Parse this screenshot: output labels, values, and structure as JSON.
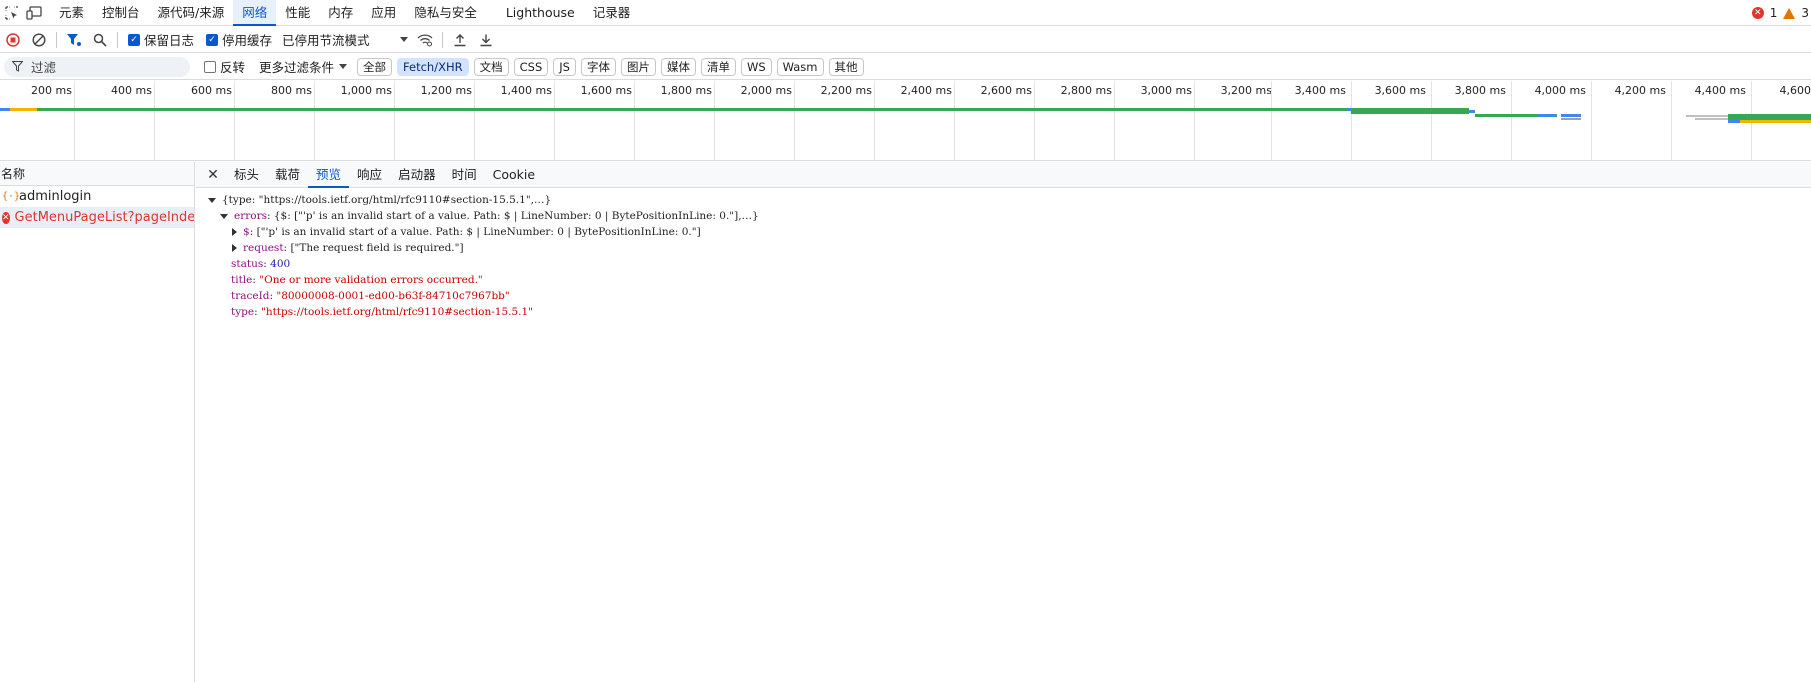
{
  "top_tabs": [
    "元素",
    "控制台",
    "源代码/来源",
    "网络",
    "性能",
    "内存",
    "应用",
    "隐私与安全",
    "Lighthouse",
    "记录器"
  ],
  "active_top_tab": "网络",
  "status": {
    "errors": "1",
    "warnings": "3"
  },
  "toolbar": {
    "preserve_log": "保留日志",
    "disable_cache": "停用缓存",
    "throttling": "已停用节流模式"
  },
  "filter": {
    "placeholder": "过滤",
    "invert": "反转",
    "more_filters": "更多过滤条件",
    "types": [
      "全部",
      "Fetch/XHR",
      "文档",
      "CSS",
      "JS",
      "字体",
      "图片",
      "媒体",
      "清单",
      "WS",
      "Wasm",
      "其他"
    ],
    "active_type": "Fetch/XHR"
  },
  "timeline_labels": [
    "200 ms",
    "400 ms",
    "600 ms",
    "800 ms",
    "1,000 ms",
    "1,200 ms",
    "1,400 ms",
    "1,600 ms",
    "1,800 ms",
    "2,000 ms",
    "2,200 ms",
    "2,400 ms",
    "2,600 ms",
    "2,800 ms",
    "3,000 ms",
    "3,200 ms",
    "3,400 ms",
    "3,600 ms",
    "3,800 ms",
    "4,000 ms",
    "4,200 ms",
    "4,400 ms",
    "4,600"
  ],
  "requests": {
    "header": "名称",
    "items": [
      {
        "name": "adminlogin",
        "status": "ok"
      },
      {
        "name": "GetMenuPageList?pageInde...",
        "status": "error"
      }
    ]
  },
  "detail_tabs": [
    "标头",
    "载荷",
    "预览",
    "响应",
    "启动器",
    "时间",
    "Cookie"
  ],
  "active_detail_tab": "预览",
  "preview": {
    "root_summary": "{type: \"https://tools.ietf.org/html/rfc9110#section-15.5.1\",…}",
    "errors_key": "errors",
    "errors_summary": "{$: [\"'p' is an invalid start of a value. Path: $ | LineNumber: 0 | BytePositionInLine: 0.\"],…}",
    "dollar_key": "$",
    "dollar_value": "[\"'p' is an invalid start of a value. Path: $ | LineNumber: 0 | BytePositionInLine: 0.\"]",
    "request_key": "request",
    "request_value": "[\"The request field is required.\"]",
    "status_key": "status",
    "status_value": "400",
    "title_key": "title",
    "title_value": "\"One or more validation errors occurred.\"",
    "traceId_key": "traceId",
    "traceId_value": "\"80000008-0001-ed00-b63f-84710c7967bb\"",
    "type_key": "type",
    "type_value": "\"https://tools.ietf.org/html/rfc9110#section-15.5.1\""
  }
}
